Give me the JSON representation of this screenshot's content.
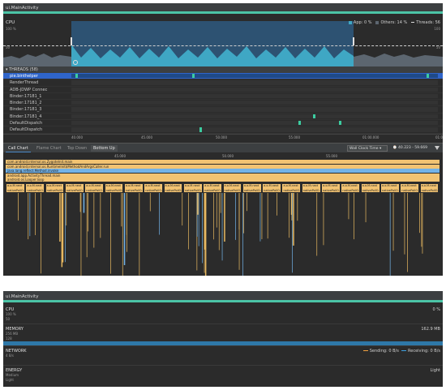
{
  "colors": {
    "accent_green": "#4bc4a6",
    "selection_blue": "#2d5272",
    "app_cpu": "#3fa7c4",
    "others_cpu": "#5c6670",
    "thread_active": "#3ccca0",
    "call_orange": "#f2c372",
    "call_blue": "#73b3e8",
    "memory_blue": "#2e78a8",
    "sending": "#f0a040",
    "receiving": "#3fa0e0"
  },
  "top": {
    "title": "ui.MainActivity",
    "cpu": {
      "label": "CPU",
      "axis_top_left": "100 %",
      "axis_mid_left": "50",
      "axis_top_right": "100",
      "axis_mid_right": "50",
      "legend_app": "App: 0 %",
      "legend_others": "Others: 14 %",
      "legend_threads": "Threads: 56"
    },
    "threads_header": "▾ THREADS (58)",
    "threads": [
      {
        "name": "pie.binthelper",
        "marks": [
          1,
          33,
          97
        ]
      },
      {
        "name": "RenderThread",
        "marks": []
      },
      {
        "name": "ADB-JDWP Connec",
        "marks": []
      },
      {
        "name": "Binder:17181_1",
        "marks": []
      },
      {
        "name": "Binder:17181_2",
        "marks": []
      },
      {
        "name": "Binder:17181_3",
        "marks": []
      },
      {
        "name": "Binder:17181_4",
        "marks": [
          66
        ]
      },
      {
        "name": "DefaultDispatch",
        "marks": [
          62,
          73
        ]
      },
      {
        "name": "DefaultDispatch",
        "marks": [
          35
        ]
      },
      {
        "name": "DefaultDispatch",
        "marks": [
          76
        ]
      }
    ],
    "time_ticks": [
      "40.000",
      "45.000",
      "50.000",
      "55.000",
      "01:00.000",
      "01:05.000"
    ],
    "tabs": {
      "call_chart": "Call Chart",
      "flame_chart": "Flame Chart",
      "top_down": "Top Down",
      "bottom_up": "Bottom Up"
    },
    "clock_select": "Wall Clock Time",
    "range": "⌚ 40.223 - 59.669",
    "cc_ticks": [
      "45.000",
      "50.000",
      "55.000"
    ],
    "call_stack": [
      "com.android.internal.os.ZygoteInit.main",
      "com.android.internal.os.RuntimeInit$MethodAndArgsCaller.run",
      "java.lang.reflect.Method.invoke",
      "android.app.ActivityThread.main",
      "android.os.Looper.loop"
    ],
    "native_label_top": "a.o.M.next",
    "native_label_bottom": "nativePollO..."
  },
  "bottom": {
    "title": "ui.MainActivity",
    "cpu_label": "CPU",
    "cpu_sub1": "100 %",
    "cpu_sub2": "50",
    "cpu_value": "0 %",
    "memory_label": "MEMORY",
    "memory_sub1": "256 MB",
    "memory_sub2": "128",
    "memory_value": "162.9 MB",
    "network_label": "NETWORK",
    "network_sub": "4 B/s",
    "sending": "Sending: 0 B/s",
    "receiving": "Receiving: 0 B/s",
    "energy_label": "ENERGY",
    "energy_sub1": "Medium",
    "energy_sub2": "Light",
    "energy_value": "Light"
  }
}
